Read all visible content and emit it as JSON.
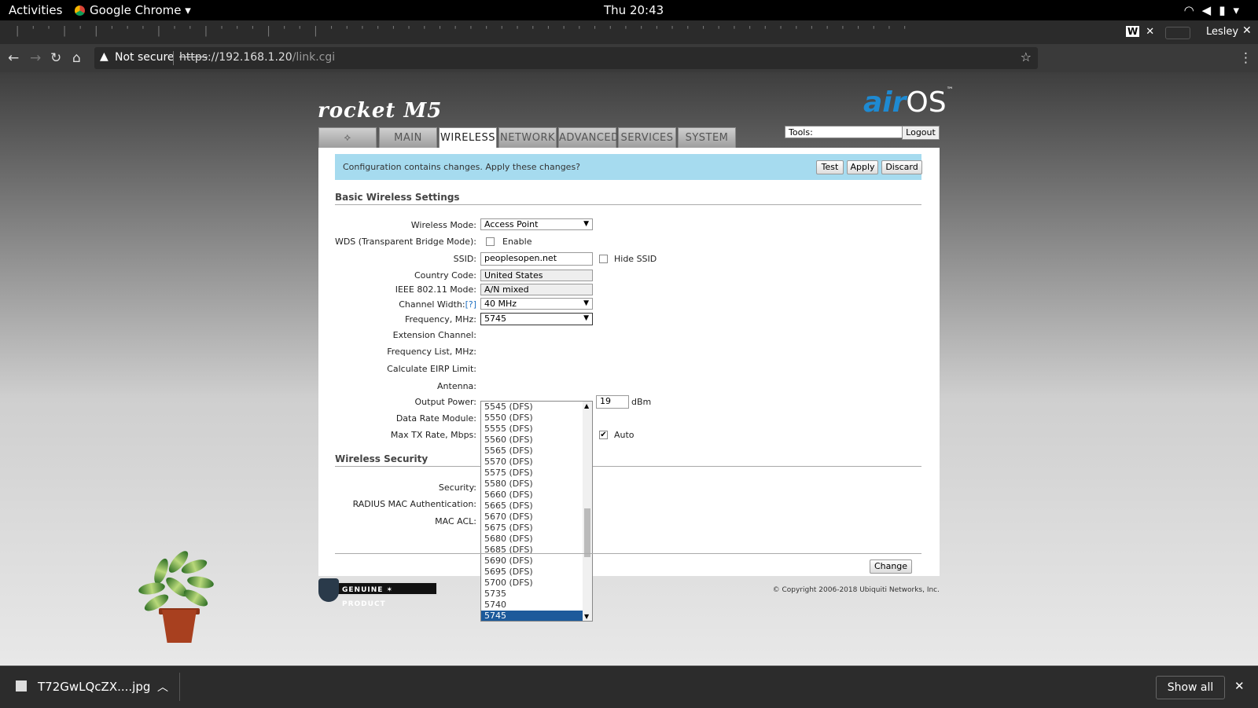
{
  "topbar": {
    "activities": "Activities",
    "app": "Google Chrome",
    "clock": "Thu 20:43"
  },
  "tabstrip": {
    "user": "Lesley",
    "tab_letter": "W"
  },
  "omnibox": {
    "security": "Not secure",
    "url_proto": "https",
    "url_host": "://192.168.1.20",
    "url_path": "/link.cgi"
  },
  "header": {
    "product": "rocket M5",
    "brand_air": "air",
    "brand_os": "OS",
    "tm": "™"
  },
  "tabs": [
    "MAIN",
    "WIRELESS",
    "NETWORK",
    "ADVANCED",
    "SERVICES",
    "SYSTEM"
  ],
  "tools": {
    "label": "Tools:",
    "logout": "Logout"
  },
  "notice": {
    "text": "Configuration contains changes. Apply these changes?",
    "test": "Test",
    "apply": "Apply",
    "discard": "Discard"
  },
  "basic": {
    "title": "Basic Wireless Settings",
    "wireless_mode_label": "Wireless Mode:",
    "wireless_mode": "Access Point",
    "wds_label": "WDS (Transparent Bridge Mode):",
    "wds_enable": "Enable",
    "ssid_label": "SSID:",
    "ssid": "peoplesopen.net",
    "hide_ssid": "Hide SSID",
    "country_label": "Country Code:",
    "country": "United States",
    "ieee_label": "IEEE 802.11 Mode:",
    "ieee": "A/N mixed",
    "channel_width_label": "Channel Width:",
    "channel_width_help": "[?]",
    "channel_width": "40 MHz",
    "frequency_label": "Frequency, MHz:",
    "frequency": "5745",
    "extension_label": "Extension Channel:",
    "freq_list_label": "Frequency List, MHz:",
    "eirp_label": "Calculate EIRP Limit:",
    "antenna_label": "Antenna:",
    "output_power_label": "Output Power:",
    "output_power": "19",
    "output_unit": "dBm",
    "data_rate_label": "Data Rate Module:",
    "max_tx_label": "Max TX Rate, Mbps:",
    "max_tx_auto": "Auto"
  },
  "freq_options": [
    "5545 (DFS)",
    "5550 (DFS)",
    "5555 (DFS)",
    "5560 (DFS)",
    "5565 (DFS)",
    "5570 (DFS)",
    "5575 (DFS)",
    "5580 (DFS)",
    "5660 (DFS)",
    "5665 (DFS)",
    "5670 (DFS)",
    "5675 (DFS)",
    "5680 (DFS)",
    "5685 (DFS)",
    "5690 (DFS)",
    "5695 (DFS)",
    "5700 (DFS)",
    "5735",
    "5740",
    "5745"
  ],
  "security": {
    "title": "Wireless Security",
    "security_label": "Security:",
    "radius_label": "RADIUS MAC Authentication:",
    "mac_acl_label": "MAC ACL:"
  },
  "footer": {
    "change": "Change",
    "genuine": "GENUINE",
    "product": "PRODUCT",
    "copyright": "© Copyright 2006-2018 Ubiquiti Networks, Inc."
  },
  "downloads": {
    "file": "T72GwLQcZX....jpg",
    "show_all": "Show all"
  }
}
